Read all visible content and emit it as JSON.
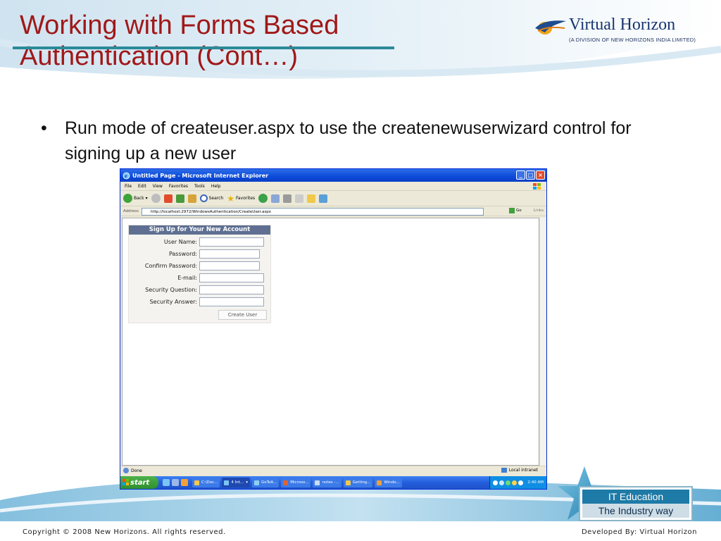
{
  "slide": {
    "title_line1": "Working with Forms Based",
    "title_line2": "Authentication (Cont…)",
    "logo_name": "Virtual Horizon",
    "logo_sub": "(A DIVISION OF NEW HORIZONS INDIA LIMITED)",
    "bullet_symbol": "•",
    "bullet_text": "Run mode of createuser.aspx to use the createnewuserwizard control for signing up a new user",
    "badge_top": "IT Education",
    "badge_bottom": "The Industry way",
    "footer_left": "Copyright © 2008 New Horizons. All rights reserved.",
    "footer_right": "Developed By: Virtual Horizon"
  },
  "browser": {
    "title": "Untitled Page - Microsoft Internet Explorer",
    "menu": [
      "File",
      "Edit",
      "View",
      "Favorites",
      "Tools",
      "Help"
    ],
    "toolbar": {
      "back": "Back",
      "search": "Search",
      "favorites": "Favorites"
    },
    "address_label": "Address",
    "address_url": "http://localhost:2972/WindowsAuthentication/CreateUser.aspx",
    "go_label": "Go",
    "links_label": "Links",
    "status": "Done",
    "zone": "Local intranet"
  },
  "wizard": {
    "header": "Sign Up for Your New Account",
    "fields": [
      {
        "label": "User Name:"
      },
      {
        "label": "Password:"
      },
      {
        "label": "Confirm Password:"
      },
      {
        "label": "E-mail:"
      },
      {
        "label": "Security Question:"
      },
      {
        "label": "Security Answer:"
      }
    ],
    "submit": "Create User"
  },
  "taskbar": {
    "start": "start",
    "items": [
      "C:\\Doc...",
      "4 Int...",
      "GoToA...",
      "Microso...",
      "notes -...",
      "Getting...",
      "Windo..."
    ],
    "clock": "2:40 AM"
  },
  "colors": {
    "title_red": "#a01818",
    "xp_blue": "#0a4ad8",
    "wizard_header": "#5e6f92",
    "badge_blue": "#1e7aa6"
  }
}
